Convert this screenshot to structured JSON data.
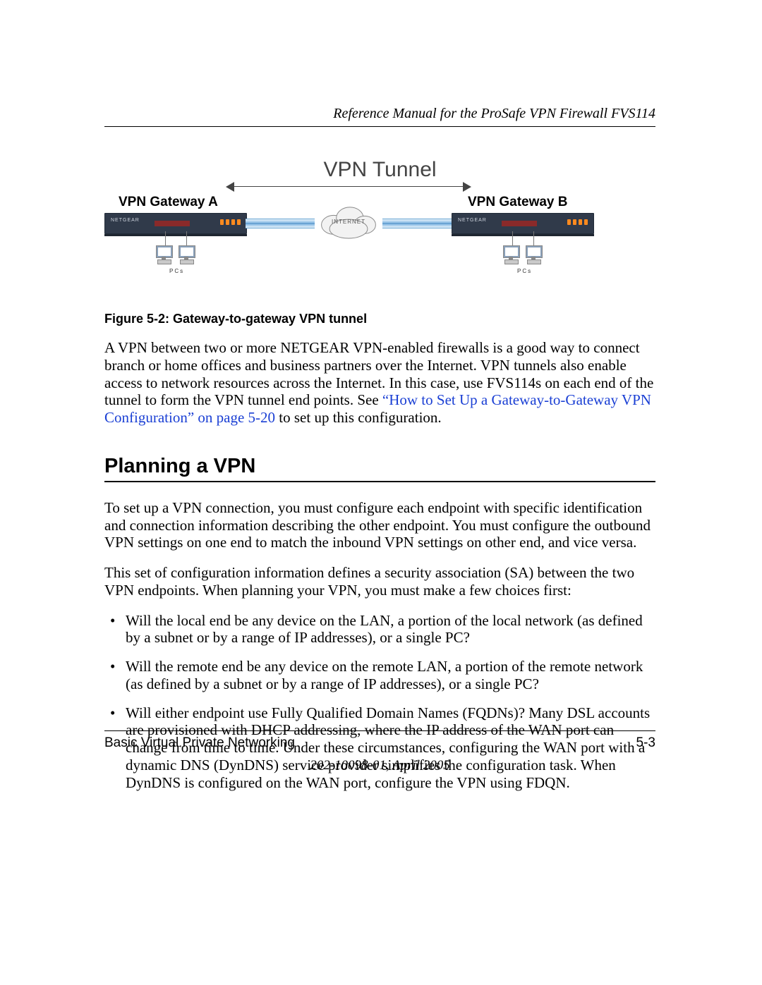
{
  "header": {
    "running_title": "Reference Manual for the ProSafe VPN Firewall FVS114"
  },
  "diagram": {
    "tunnel_label": "VPN Tunnel",
    "gateway_a": "VPN Gateway A",
    "gateway_b": "VPN Gateway B",
    "cloud_label": "INTERNET",
    "device_brand": "NETGEAR",
    "pcs_label": "PCs"
  },
  "figure": {
    "caption": "Figure 5-2:  Gateway-to-gateway VPN tunnel"
  },
  "body": {
    "p1_pre": "A VPN between two or more NETGEAR VPN-enabled firewalls is a good way to connect branch or home offices and business partners over the Internet. VPN tunnels also enable access to network resources across the Internet. In this case, use FVS114s on each end of the tunnel to form the VPN tunnel end points. See ",
    "p1_link": "“How to Set Up a Gateway-to-Gateway VPN Configuration” on page 5-20",
    "p1_post": " to set up this configuration."
  },
  "section": {
    "title": "Planning a VPN",
    "p1": "To set up a VPN connection, you must configure each endpoint with specific identification and connection information describing the other endpoint. You must configure the outbound VPN settings on one end to match the inbound VPN settings on other end, and vice versa.",
    "p2": "This set of configuration information defines a security association (SA) between the two VPN endpoints. When planning your VPN, you must make a few choices first:",
    "bullets": [
      "Will the local end be any device on the LAN, a portion of the local network (as defined by a subnet or by a range of IP addresses), or a single PC?",
      "Will the remote end be any device on the remote LAN, a portion of the remote network (as defined by a subnet or by a range of IP addresses), or a single PC?",
      "Will either endpoint use Fully Qualified Domain Names (FQDNs)? Many DSL accounts are provisioned with DHCP addressing, where the IP address of the WAN port can change from time to time. Under these circumstances, configuring the WAN port with a dynamic DNS (DynDNS) service provider simplifies the configuration task. When DynDNS is configured on the WAN port, configure the VPN using FDQN."
    ]
  },
  "footer": {
    "chapter": "Basic Virtual Private Networking",
    "page": "5-3",
    "doc_id": "202-10098-01, April 2005"
  }
}
